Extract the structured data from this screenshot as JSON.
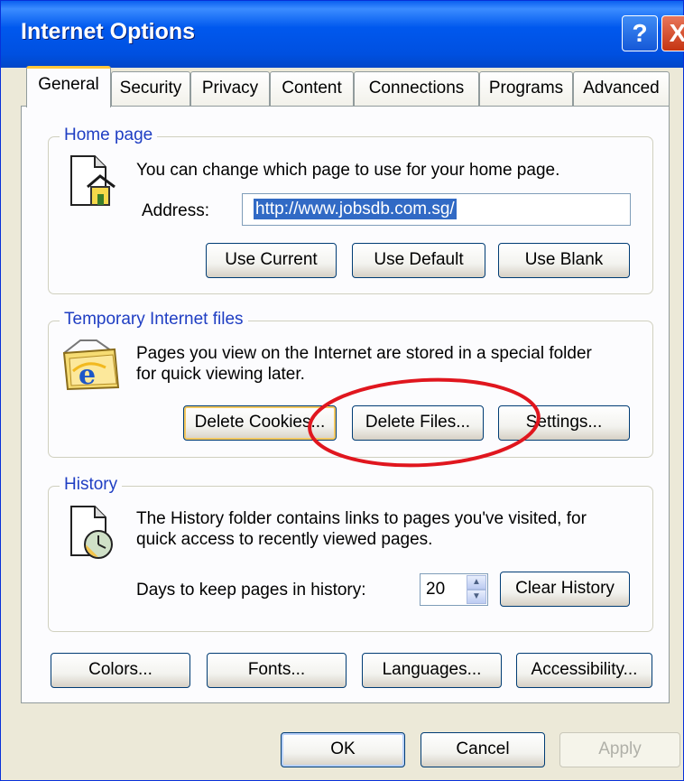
{
  "window": {
    "title": "Internet Options",
    "help_glyph": "?",
    "close_glyph": "X"
  },
  "tabs": [
    {
      "label": "General",
      "active": true
    },
    {
      "label": "Security"
    },
    {
      "label": "Privacy"
    },
    {
      "label": "Content"
    },
    {
      "label": "Connections"
    },
    {
      "label": "Programs"
    },
    {
      "label": "Advanced"
    }
  ],
  "home_page": {
    "legend": "Home page",
    "description": "You can change which page to use for your home page.",
    "address_label": "Address:",
    "address_value": "http://www.jobsdb.com.sg/",
    "buttons": {
      "use_current": "Use Current",
      "use_default": "Use Default",
      "use_blank": "Use Blank"
    },
    "icon": "home-page-icon"
  },
  "temp_files": {
    "legend": "Temporary Internet files",
    "description_line1": "Pages you view on the Internet are stored in a special folder",
    "description_line2": "for quick viewing later.",
    "buttons": {
      "delete_cookies": "Delete Cookies...",
      "delete_files": "Delete Files...",
      "settings": "Settings..."
    },
    "icon": "ie-folder-icon"
  },
  "history": {
    "legend": "History",
    "description_line1": "The History folder contains links to pages you've visited, for",
    "description_line2": "quick access to recently viewed pages.",
    "days_label": "Days to keep pages in history:",
    "days_value": "20",
    "clear_button": "Clear History",
    "icon": "history-clock-icon"
  },
  "bottom_buttons": {
    "colors": "Colors...",
    "fonts": "Fonts...",
    "languages": "Languages...",
    "accessibility": "Accessibility..."
  },
  "dialog_buttons": {
    "ok": "OK",
    "cancel": "Cancel",
    "apply": "Apply"
  },
  "annotation": {
    "shape": "ellipse",
    "color": "#e0161e",
    "target": "delete-files-button"
  },
  "colors": {
    "titlebar": "#0054e3",
    "dialog_face": "#ece9d8",
    "legend_text": "#1f3ec3",
    "selection": "#316ac5"
  }
}
